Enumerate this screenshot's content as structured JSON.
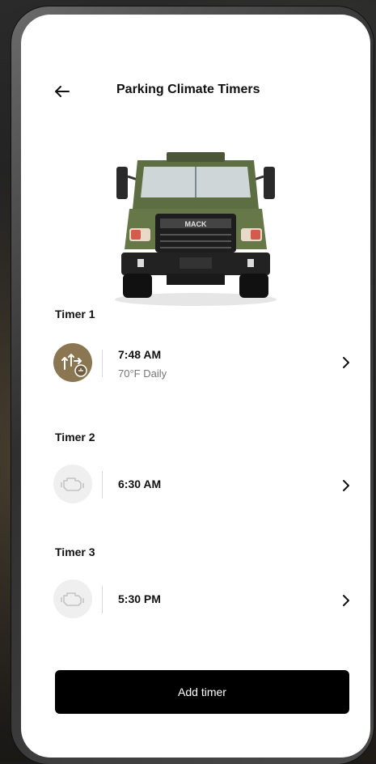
{
  "header": {
    "title": "Parking Climate Timers",
    "back_icon": "arrow-left-icon"
  },
  "vehicle": {
    "brand_text": "MACK",
    "body_color": "#5e6e43"
  },
  "timers": [
    {
      "label": "Timer 1",
      "time": "7:48 AM",
      "detail": "70°F Daily",
      "icon": "climate-active-icon",
      "active": true
    },
    {
      "label": "Timer 2",
      "time": "6:30 AM",
      "detail": "",
      "icon": "engine-icon",
      "active": false
    },
    {
      "label": "Timer 3",
      "time": "5:30 PM",
      "detail": "",
      "icon": "engine-icon",
      "active": false
    }
  ],
  "add_button": {
    "label": "Add timer"
  },
  "colors": {
    "accent_bronze": "#8a7752",
    "button_bg": "#000000",
    "inactive_icon_bg": "#efefef"
  }
}
